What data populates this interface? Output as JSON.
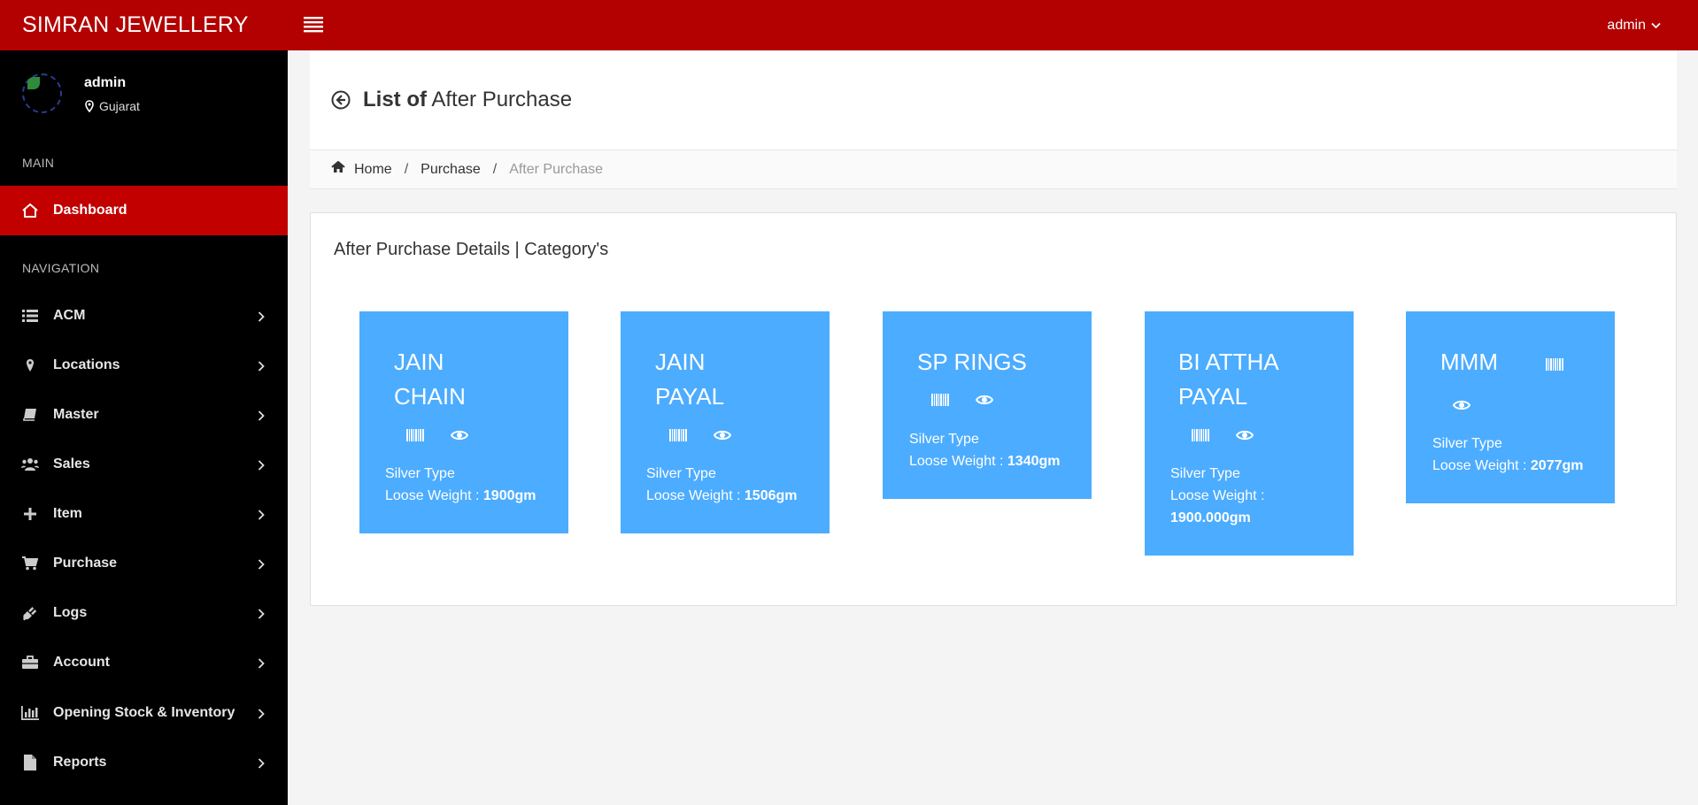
{
  "topbar": {
    "brand": "SIMRAN JEWELLERY",
    "user": "admin",
    "color": "#b30000"
  },
  "sidebar": {
    "profile": {
      "name": "admin",
      "location": "Gujarat"
    },
    "sections": {
      "main": "MAIN",
      "navigation": "NAVIGATION"
    },
    "dashboard": {
      "label": "Dashboard",
      "icon": "home-icon"
    },
    "items": [
      {
        "label": "ACM",
        "icon": "list-icon"
      },
      {
        "label": "Locations",
        "icon": "map-marker-icon"
      },
      {
        "label": "Master",
        "icon": "book-icon"
      },
      {
        "label": "Sales",
        "icon": "users-icon"
      },
      {
        "label": "Item",
        "icon": "plus-icon"
      },
      {
        "label": "Purchase",
        "icon": "cart-icon"
      },
      {
        "label": "Logs",
        "icon": "plug-icon"
      },
      {
        "label": "Account",
        "icon": "briefcase-icon"
      },
      {
        "label": "Opening Stock & Inventory",
        "icon": "bar-chart-icon"
      },
      {
        "label": "Reports",
        "icon": "file-icon"
      }
    ],
    "active_color": "#c20000"
  },
  "header": {
    "title_bold": "List of",
    "title_rest": "After Purchase"
  },
  "breadcrumb": {
    "home": "Home",
    "purchase": "Purchase",
    "current": "After Purchase"
  },
  "panel": {
    "title": "After Purchase Details | Category's",
    "card_color": "#4cacff",
    "cards": [
      {
        "name_line1": "JAIN",
        "name_line2": "CHAIN",
        "type": "Silver Type",
        "weight_label": "Loose Weight :",
        "weight": "1900gm"
      },
      {
        "name_line1": "JAIN",
        "name_line2": "PAYAL",
        "type": "Silver Type",
        "weight_label": "Loose Weight :",
        "weight": "1506gm"
      },
      {
        "name_line1": "SP RINGS",
        "type": "Silver Type",
        "weight_label": "Loose Weight :",
        "weight": "1340gm"
      },
      {
        "name_line1": "BI ATTHA",
        "name_line2": "PAYAL",
        "type": "Silver Type",
        "weight_label": "Loose Weight :",
        "weight": "1900.000gm"
      },
      {
        "name_line1": "MMM",
        "type": "Silver Type",
        "weight_label": "Loose Weight :",
        "weight": "2077gm"
      }
    ]
  }
}
